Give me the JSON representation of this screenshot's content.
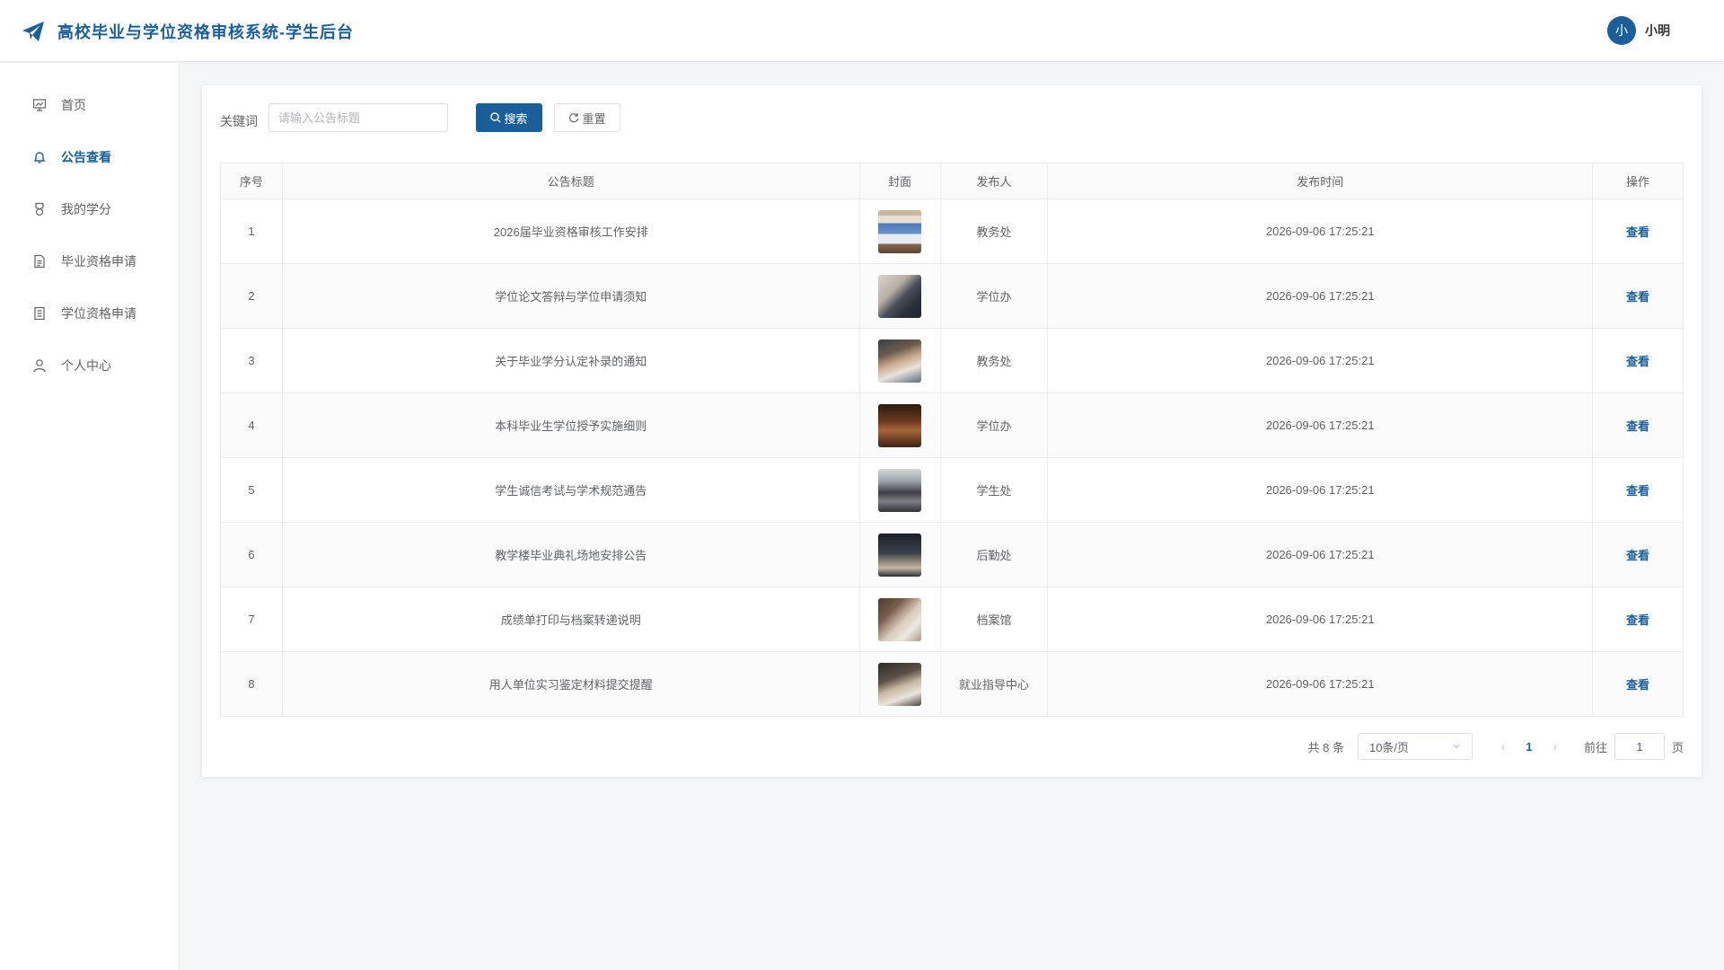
{
  "app": {
    "title": "高校毕业与学位资格审核系统-学生后台"
  },
  "user": {
    "avatar_text": "小",
    "name": "小明"
  },
  "sidebar": {
    "items": [
      {
        "label": "首页",
        "icon": "presentation-icon"
      },
      {
        "label": "公告查看",
        "icon": "bell-icon",
        "active": true
      },
      {
        "label": "我的学分",
        "icon": "medal-icon"
      },
      {
        "label": "毕业资格申请",
        "icon": "document-icon"
      },
      {
        "label": "学位资格申请",
        "icon": "document-list-icon"
      },
      {
        "label": "个人中心",
        "icon": "user-icon"
      }
    ]
  },
  "search": {
    "label": "关键词",
    "placeholder": "请输入公告标题",
    "value": "",
    "search_label": "搜索",
    "reset_label": "重置"
  },
  "table": {
    "headers": [
      "序号",
      "公告标题",
      "封面",
      "发布人",
      "发布时间",
      "操作"
    ],
    "action_label": "查看",
    "rows": [
      {
        "index": "1",
        "title": "2026届毕业资格审核工作安排",
        "publisher": "教务处",
        "time": "2026-09-06 17:25:21"
      },
      {
        "index": "2",
        "title": "学位论文答辩与学位申请须知",
        "publisher": "学位办",
        "time": "2026-09-06 17:25:21"
      },
      {
        "index": "3",
        "title": "关于毕业学分认定补录的通知",
        "publisher": "教务处",
        "time": "2026-09-06 17:25:21"
      },
      {
        "index": "4",
        "title": "本科毕业生学位授予实施细则",
        "publisher": "学位办",
        "time": "2026-09-06 17:25:21"
      },
      {
        "index": "5",
        "title": "学生诚信考试与学术规范通告",
        "publisher": "学生处",
        "time": "2026-09-06 17:25:21"
      },
      {
        "index": "6",
        "title": "教学楼毕业典礼场地安排公告",
        "publisher": "后勤处",
        "time": "2026-09-06 17:25:21"
      },
      {
        "index": "7",
        "title": "成绩单打印与档案转递说明",
        "publisher": "档案馆",
        "time": "2026-09-06 17:25:21"
      },
      {
        "index": "8",
        "title": "用人单位实习鉴定材料提交提醒",
        "publisher": "就业指导中心",
        "time": "2026-09-06 17:25:21"
      }
    ]
  },
  "pagination": {
    "total_text": "共 8 条",
    "page_size": "10条/页",
    "current_page": "1",
    "goto_label": "前往",
    "goto_value": "1",
    "page_unit": "页"
  },
  "colors": {
    "accent": "#1a5f9a"
  }
}
